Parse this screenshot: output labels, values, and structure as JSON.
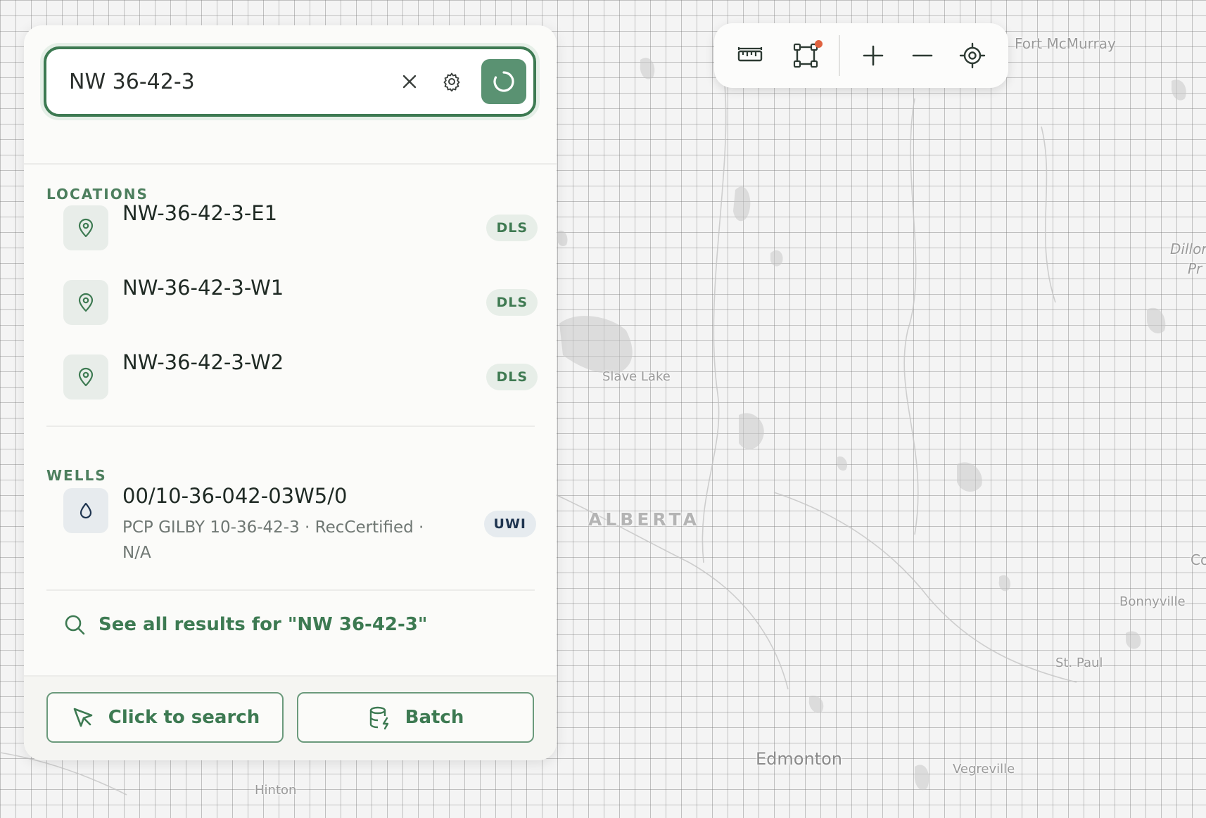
{
  "search": {
    "query": "NW 36-42-3",
    "clear_icon": "close-icon",
    "settings_icon": "gear-icon",
    "submit_icon": "loading-spinner-icon"
  },
  "sections": {
    "locations_title": "LOCATIONS",
    "wells_title": "WELLS"
  },
  "locations": [
    {
      "title": "NW-36-42-3-E1",
      "badge": "DLS",
      "icon": "map-pin-icon"
    },
    {
      "title": "NW-36-42-3-W1",
      "badge": "DLS",
      "icon": "map-pin-icon"
    },
    {
      "title": "NW-36-42-3-W2",
      "badge": "DLS",
      "icon": "map-pin-icon"
    }
  ],
  "wells": [
    {
      "title": "00/10-36-042-03W5/0",
      "subtitle": "PCP GILBY 10-36-42-3 · RecCertified · N/A",
      "badge": "UWI",
      "icon": "droplet-icon"
    }
  ],
  "see_all": {
    "label": "See all results for \"NW 36-42-3\"",
    "icon": "search-icon"
  },
  "footer": {
    "click_to_search_label": "Click to search",
    "click_to_search_icon": "cursor-arrow-icon",
    "batch_label": "Batch",
    "batch_icon": "database-bolt-icon"
  },
  "toolbar": {
    "items": [
      "ruler-icon",
      "draw-polygon-icon",
      "zoom-in-icon",
      "zoom-out-icon",
      "locate-icon"
    ]
  },
  "map": {
    "labels": {
      "fort_mcmurray": "Fort McMurray",
      "dillon": "Dillon",
      "dillon_pr": "Pr",
      "slave_lake": "Slave Lake",
      "alberta": "ALBERTA",
      "co": "Co",
      "bonnyville": "Bonnyville",
      "st_paul": "St. Paul",
      "edmonton": "Edmonton",
      "vegreville": "Vegreville",
      "hinton": "Hinton"
    }
  },
  "colors": {
    "accent": "#3d7a52",
    "accent_bg": "#5a9272",
    "notification_dot": "#e0623f"
  }
}
